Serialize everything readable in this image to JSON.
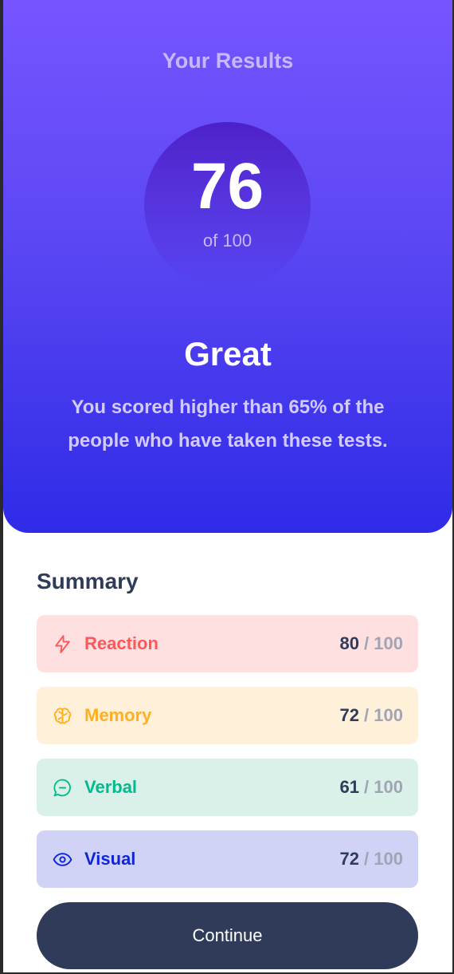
{
  "results": {
    "title": "Your Results",
    "score": "76",
    "score_max": "of 100",
    "rating": "Great",
    "description": "You scored higher than 65% of the people who have taken these tests."
  },
  "summary": {
    "title": "Summary",
    "items": [
      {
        "label": "Reaction",
        "score": "80",
        "sep": " / ",
        "max": "100",
        "icon": "lightning-icon",
        "color": "#ff5757"
      },
      {
        "label": "Memory",
        "score": "72",
        "sep": " / ",
        "max": "100",
        "icon": "brain-icon",
        "color": "#ffb01f"
      },
      {
        "label": "Verbal",
        "score": "61",
        "sep": " / ",
        "max": "100",
        "icon": "chat-bubble-icon",
        "color": "#00bb8f"
      },
      {
        "label": "Visual",
        "score": "72",
        "sep": " / ",
        "max": "100",
        "icon": "eye-icon",
        "color": "#1125d6"
      }
    ]
  },
  "actions": {
    "continue_label": "Continue"
  }
}
